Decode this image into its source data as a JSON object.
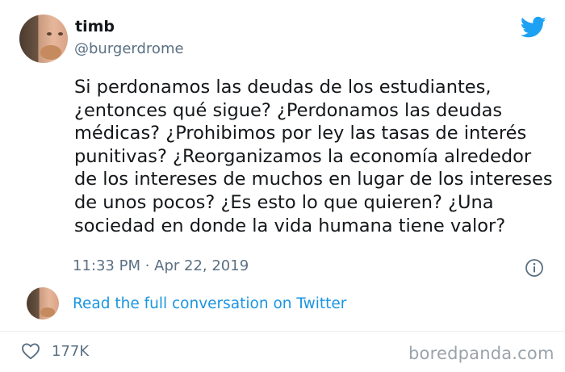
{
  "author": {
    "display_name": "timb",
    "handle": "@burgerdrome"
  },
  "tweet": {
    "text": "Si perdonamos las deudas de los estudiantes,\n¿entonces qué sigue? ¿Perdonamos las deudas\nmédicas? ¿Prohibimos por ley las tasas de interés\npunitivas? ¿Reorganizamos la economía alrededor\nde los intereses de muchos en lugar de los intereses\nde unos pocos? ¿Es esto lo que quieren? ¿Una\nsociedad en donde la vida humana tiene valor?",
    "timestamp": "11:33 PM · Apr 22, 2019"
  },
  "conversation": {
    "link_label": "Read the full conversation on Twitter"
  },
  "engagement": {
    "likes": "177K"
  },
  "watermark": "boredpanda.com",
  "colors": {
    "twitter_blue": "#1da1f2",
    "link_blue": "#1b95e0",
    "secondary_text": "#5b7083"
  },
  "icons": [
    "avatar",
    "twitter-bird-icon",
    "info-icon",
    "heart-icon"
  ]
}
